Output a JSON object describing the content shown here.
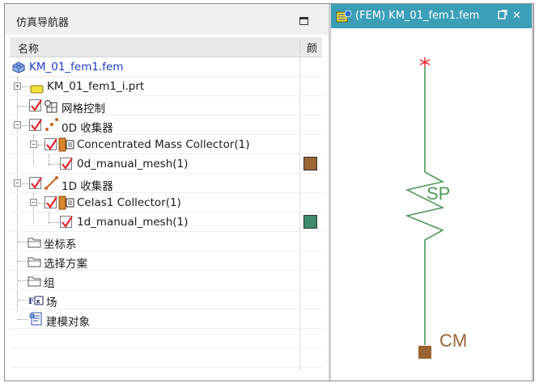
{
  "navigator": {
    "title": "仿真导航器",
    "columns": {
      "name": "名称",
      "color": "颜"
    },
    "rows": [
      {
        "label": "KM_01_fem1.fem"
      },
      {
        "label": "KM_01_fem1_i.prt"
      },
      {
        "label": "网格控制"
      },
      {
        "label": "0D 收集器"
      },
      {
        "label": "Concentrated Mass Collector(1)"
      },
      {
        "label": "0d_manual_mesh(1)",
        "color": "#9a6433"
      },
      {
        "label": "1D 收集器"
      },
      {
        "label": "Celas1 Collector(1)"
      },
      {
        "label": "1d_manual_mesh(1)",
        "color": "#3e8a6a"
      },
      {
        "label": "坐标系"
      },
      {
        "label": "选择方案"
      },
      {
        "label": "组"
      },
      {
        "label": "场"
      },
      {
        "label": "建模对象"
      }
    ]
  },
  "graphics": {
    "tab_label": "(FEM) KM_01_fem1.fem",
    "spring_label": "SP",
    "mass_label": "CM",
    "spring_color": "#4f9a5a",
    "node_color": "#e0242a",
    "mass_color": "#9a6433"
  }
}
